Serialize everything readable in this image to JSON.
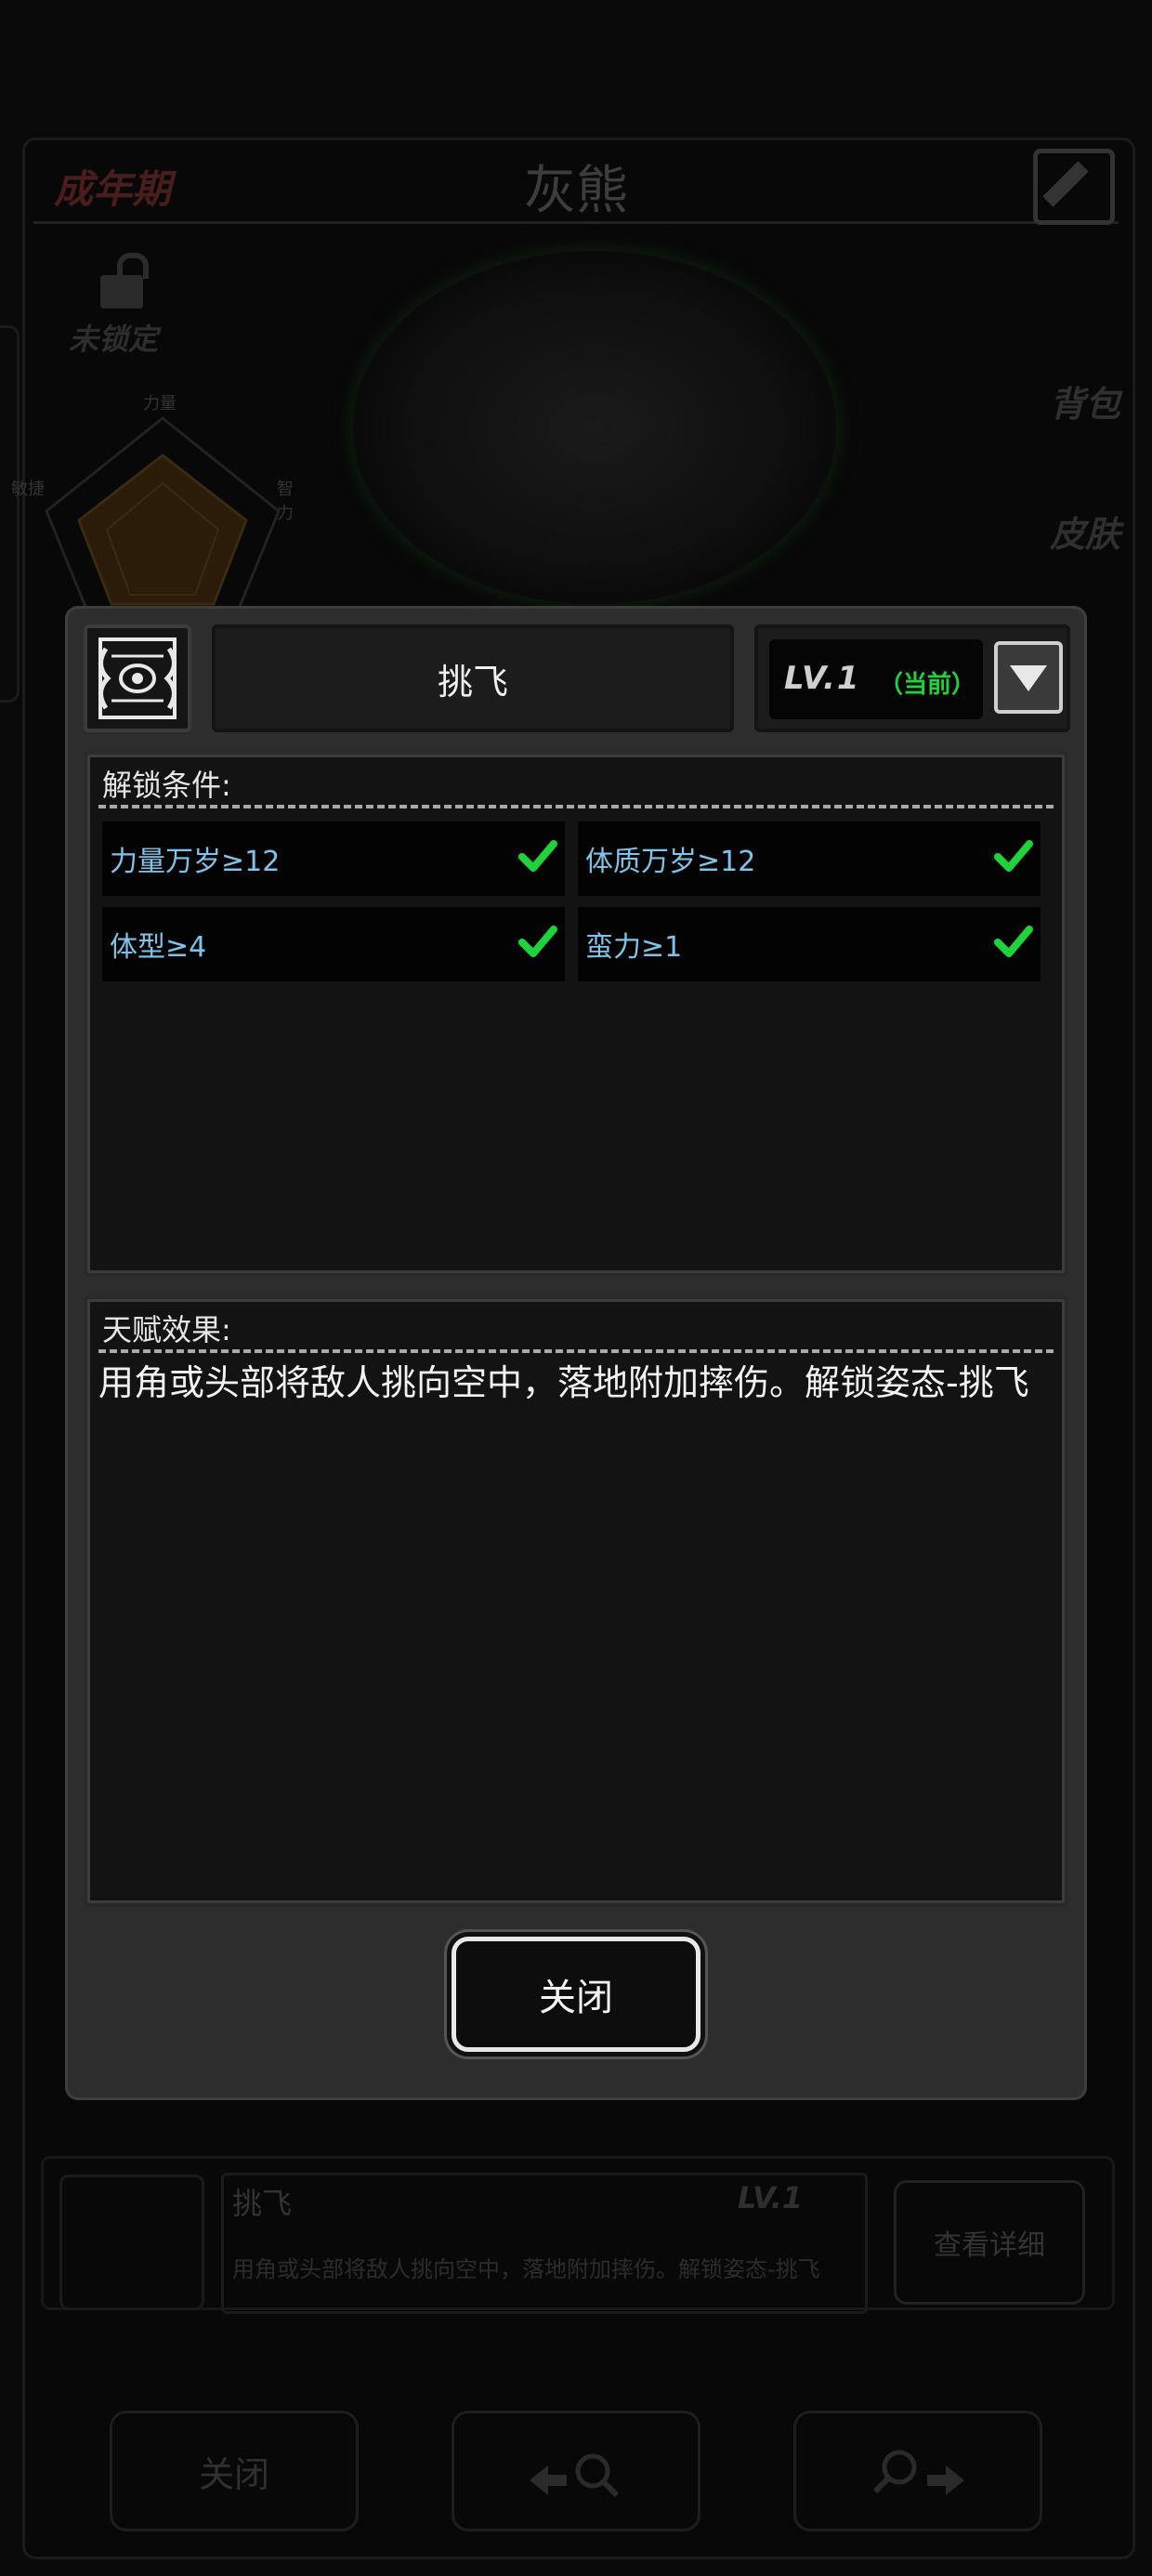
{
  "background": {
    "stage_label": "成年期",
    "animal_name": "灰熊",
    "lock_status": "未锁定",
    "radar_labels": [
      "力量",
      "敏捷",
      "智力"
    ],
    "side_buttons": [
      "背包",
      "皮肤"
    ],
    "skill": {
      "name": "挑飞",
      "level": "LV.1",
      "description": "用角或头部将敌人挑向空中，落地附加摔伤。解锁姿态-挑飞",
      "detail_button": "查看详细"
    },
    "bottom_close": "关闭"
  },
  "dialog": {
    "skill_name": "挑飞",
    "level": "LV.1",
    "current_tag": "（当前）",
    "unlock_title": "解锁条件:",
    "conditions": [
      {
        "text": "力量万岁≥12",
        "met": true
      },
      {
        "text": "体质万岁≥12",
        "met": true
      },
      {
        "text": "体型≥4",
        "met": true
      },
      {
        "text": "蛮力≥1",
        "met": true
      }
    ],
    "effect_title": "天赋效果:",
    "effect_text": "用角或头部将敌人挑向空中，落地附加摔伤。解锁姿态-挑飞",
    "close_label": "关闭"
  },
  "colors": {
    "check": "#1fd43a",
    "condition_text": "#7ec4ea",
    "current_tag": "#1fd43a",
    "dialog_bg": "#2d2d2d"
  }
}
